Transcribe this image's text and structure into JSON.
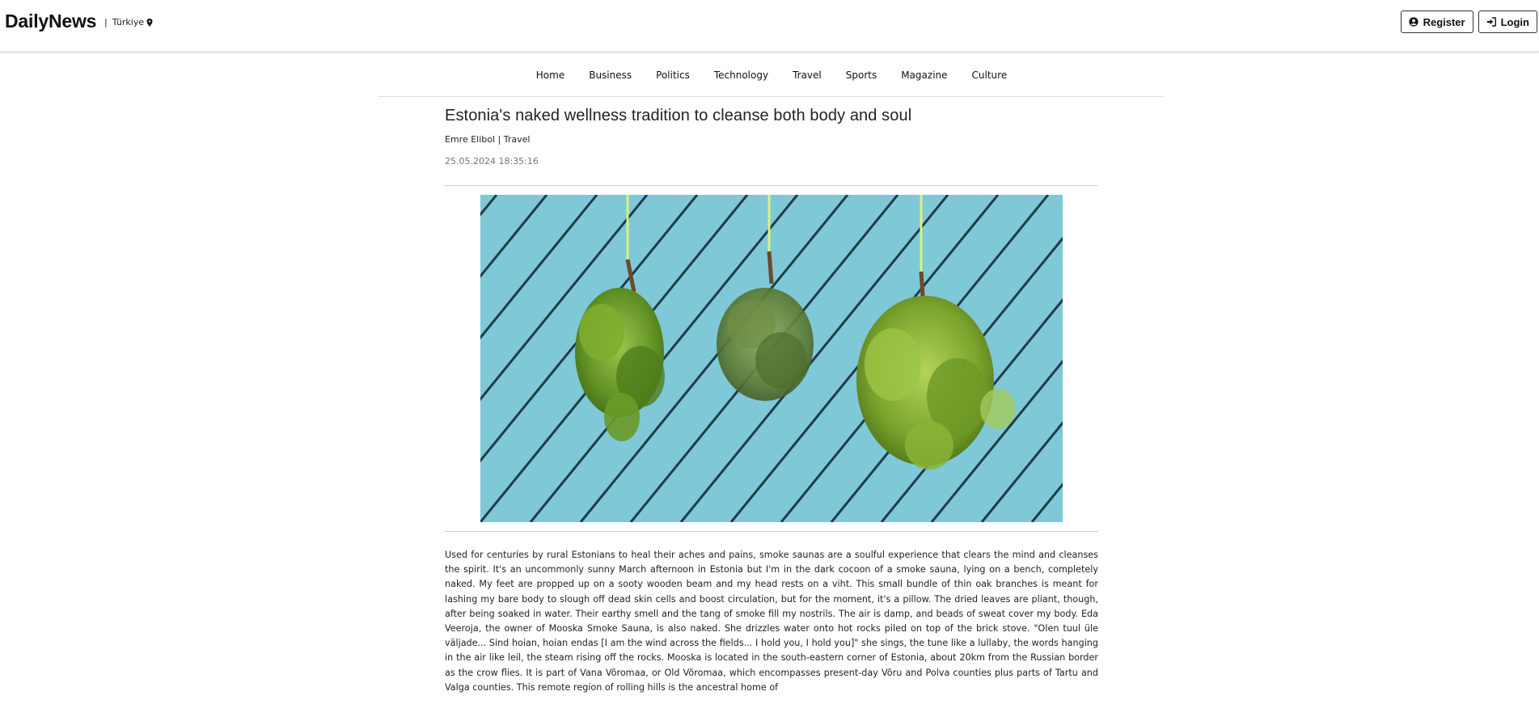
{
  "header": {
    "brand": "DailyNews",
    "region_separator": "|",
    "region": "Türkiye",
    "region_icon": "map-pin-icon",
    "register_label": "Register",
    "register_icon": "user-circle-icon",
    "login_label": "Login",
    "login_icon": "sign-in-icon"
  },
  "nav": {
    "items": [
      {
        "label": "Home"
      },
      {
        "label": "Business"
      },
      {
        "label": "Politics"
      },
      {
        "label": "Technology"
      },
      {
        "label": "Travel"
      },
      {
        "label": "Sports"
      },
      {
        "label": "Magazine"
      },
      {
        "label": "Culture"
      }
    ]
  },
  "article": {
    "title": "Estonia's naked wellness tradition to cleanse both body and soul",
    "byline": "Emre Elibol | Travel",
    "date": "25.05.2024 18:35:16",
    "body": "Used for centuries by rural Estonians to heal their aches and pains, smoke saunas are a soulful experience that clears the mind and cleanses the spirit. It's an uncommonly sunny March afternoon in Estonia but I'm in the dark cocoon of a smoke sauna, lying on a bench, completely naked. My feet are propped up on a sooty wooden beam and my head rests on a viht. This small bundle of thin oak branches is meant for lashing my bare body to slough off dead skin cells and boost circulation, but for the moment, it's a pillow. The dried leaves are pliant, though, after being soaked in water. Their earthy smell and the tang of smoke fill my nostrils. The air is damp, and beads of sweat cover my body. Eda Veeroja, the owner of Mooska Smoke Sauna, is also naked. She drizzles water onto hot rocks piled on top of the brick stove. \"Olen tuul üle väljade... Sind hoian, hoian endas [I am the wind across the fields... I hold you, I hold you]\" she sings, the tune like a lullaby, the words hanging in the air like leil, the steam rising off the rocks. Mooska is located in the south-eastern corner of Estonia, about 20km from the Russian border as the crow flies. It is part of Vana Võromaa, or Old Võromaa, which encompasses present-day Võru and Polva counties plus parts of Tartu and Valga counties. This remote region of rolling hills is the ancestral home of"
  },
  "colors": {
    "image_background": "#7cc6d6",
    "plank_gap": "#1d3c48",
    "leaf_green": "#7fae2e"
  }
}
